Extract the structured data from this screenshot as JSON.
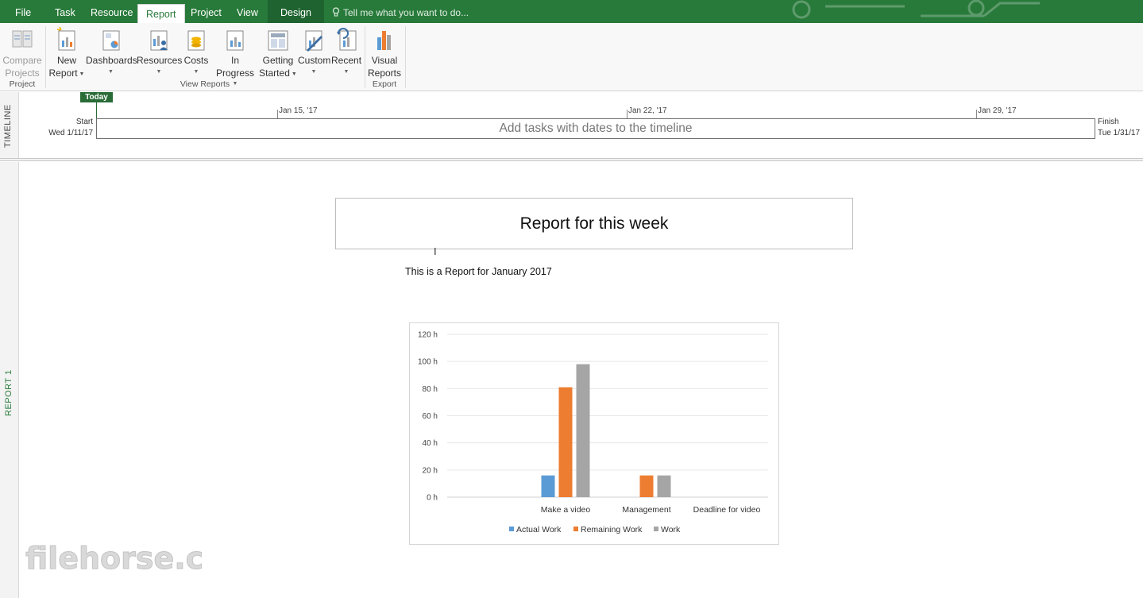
{
  "tabs": [
    {
      "label": "File"
    },
    {
      "label": "Task"
    },
    {
      "label": "Resource"
    },
    {
      "label": "Report"
    },
    {
      "label": "Project"
    },
    {
      "label": "View"
    },
    {
      "label": "Design"
    }
  ],
  "tellme": "Tell me what you want to do...",
  "ribbon": {
    "compare": {
      "line1": "Compare",
      "line2": "Projects"
    },
    "new_report": {
      "line1": "New",
      "line2": "Report"
    },
    "dashboards": {
      "line1": "Dashboards"
    },
    "resources": {
      "line1": "Resources"
    },
    "costs": {
      "line1": "Costs"
    },
    "in_progress": {
      "line1": "In Progress"
    },
    "getting_started": {
      "line1": "Getting",
      "line2": "Started"
    },
    "custom": {
      "line1": "Custom"
    },
    "recent": {
      "line1": "Recent"
    },
    "visual_reports": {
      "line1": "Visual",
      "line2": "Reports"
    },
    "groups": {
      "project": "Project",
      "view_reports": "View Reports",
      "export": "Export"
    }
  },
  "timeline": {
    "side_label": "TIMELINE",
    "today": "Today",
    "ticks": [
      "Jan 15, '17",
      "Jan 22, '17",
      "Jan 29, '17"
    ],
    "start_label": "Start",
    "start_date": "Wed 1/11/17",
    "finish_label": "Finish",
    "finish_date": "Tue 1/31/17",
    "placeholder": "Add tasks with dates to the timeline"
  },
  "report": {
    "side_label": "REPORT 1",
    "title": "Report for this week",
    "subtitle": "This is a Report for January 2017"
  },
  "watermark": "filehorse.com",
  "chart_data": {
    "type": "bar",
    "categories": [
      "Make a video",
      "Management",
      "Deadline for video"
    ],
    "series": [
      {
        "name": "Actual Work",
        "color": "#5b9bd5",
        "values": [
          16,
          0,
          0
        ]
      },
      {
        "name": "Remaining Work",
        "color": "#ed7d31",
        "values": [
          81,
          16,
          0
        ]
      },
      {
        "name": "Work",
        "color": "#a5a5a5",
        "values": [
          98,
          16,
          0
        ]
      }
    ],
    "yticks": [
      "0 h",
      "20 h",
      "40 h",
      "60 h",
      "80 h",
      "100 h",
      "120 h"
    ],
    "ylim": [
      0,
      120
    ],
    "legend": "bottom",
    "grid": true
  }
}
